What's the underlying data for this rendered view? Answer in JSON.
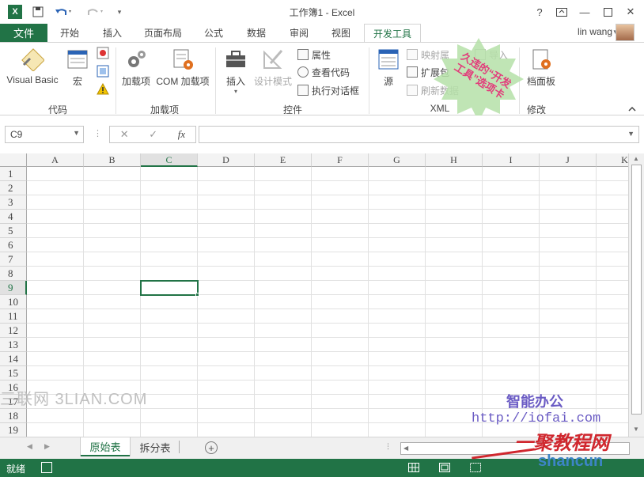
{
  "window": {
    "title": "工作簿1 - Excel",
    "help": "?",
    "minimize": "—",
    "close": "✕"
  },
  "tabs": {
    "file": "文件",
    "items": [
      "开始",
      "插入",
      "页面布局",
      "公式",
      "数据",
      "审阅",
      "视图",
      "开发工具"
    ],
    "active": "开发工具",
    "user": "lin wang"
  },
  "ribbon": {
    "groups": {
      "code": "代码",
      "addins": "加载项",
      "controls": "控件",
      "xml": "XML",
      "modify": "修改"
    },
    "buttons": {
      "visual_basic": "Visual Basic",
      "macro": "宏",
      "addins": "加载项",
      "com_addins": "COM 加载项",
      "insert": "插入",
      "design_mode": "设计模式",
      "properties": "属性",
      "view_code": "查看代码",
      "run_dialog": "执行对话框",
      "source": "源",
      "map_properties": "映射属",
      "expansion_packs": "扩展包",
      "refresh_data": "刷新数据",
      "import": "导入",
      "doc_panel": "档面板"
    },
    "stamp": {
      "line1": "久违的“开发",
      "line2": "工具”选项卡"
    }
  },
  "formula_bar": {
    "name_box": "C9",
    "fx": "fx",
    "cancel": "✕",
    "enter": "✓",
    "formula": ""
  },
  "grid": {
    "columns": [
      "A",
      "B",
      "C",
      "D",
      "E",
      "F",
      "G",
      "H",
      "I",
      "J",
      "K"
    ],
    "rows": [
      "1",
      "2",
      "3",
      "4",
      "5",
      "6",
      "7",
      "8",
      "9",
      "10",
      "11",
      "12",
      "13",
      "14",
      "15",
      "16",
      "17",
      "18",
      "19"
    ],
    "active_col": "C",
    "active_row": "9"
  },
  "sheets": {
    "items": [
      "原始表",
      "拆分表"
    ],
    "active": "原始表",
    "add": "+"
  },
  "status": {
    "ready": "就绪"
  },
  "watermarks": {
    "left": "三联网 3LIAN.COM",
    "right_title": "智能办公",
    "right_url": "http://iofai.com",
    "brand": "一聚教程网",
    "brand_url": "shancun"
  },
  "colors": {
    "accent": "#217346",
    "stamp": "#b5e0a8"
  }
}
